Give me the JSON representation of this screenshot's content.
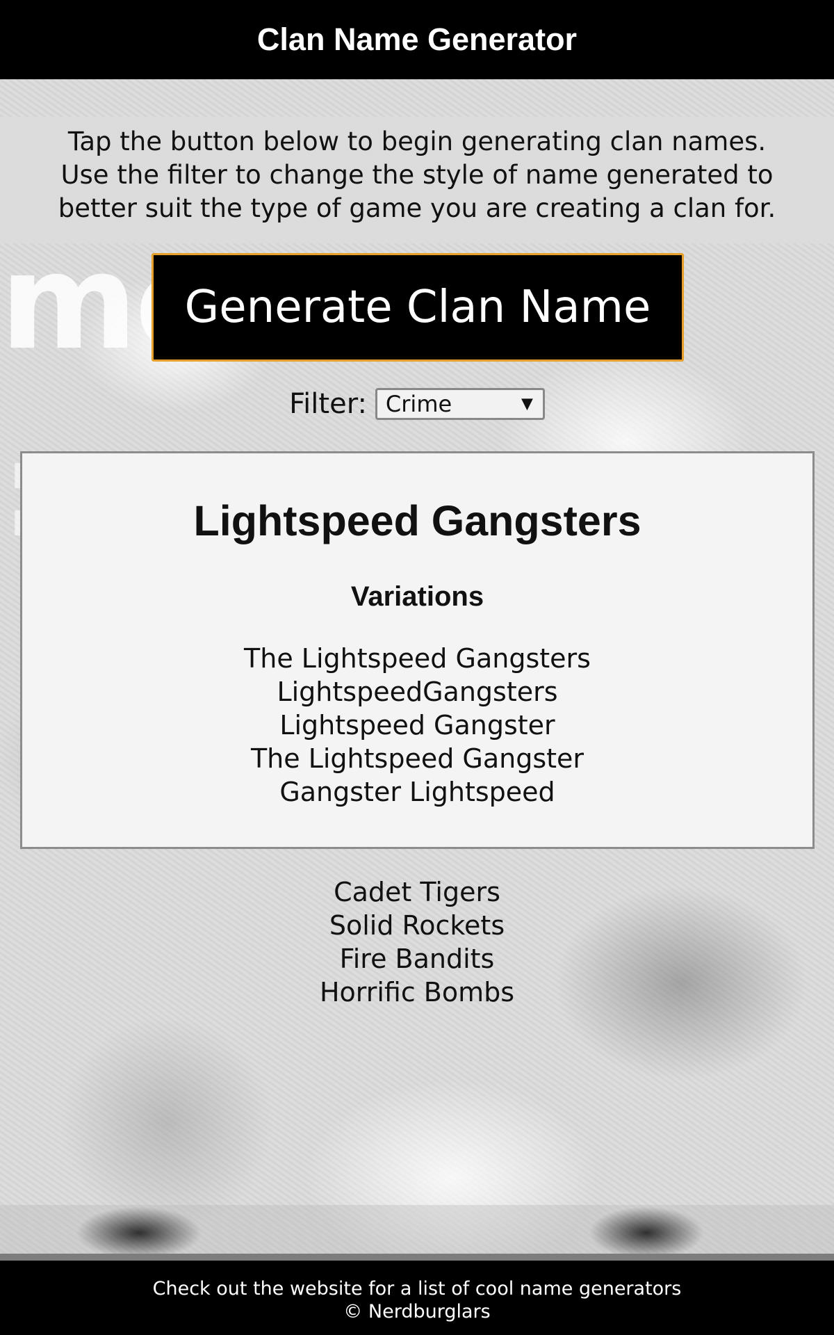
{
  "header": {
    "title": "Clan Name Generator"
  },
  "intro": {
    "lines": [
      "Tap the button below to begin generating clan names.",
      "Use the filter to change the style of name generated to",
      "better suit the type of game you are creating a clan for."
    ]
  },
  "generate_button": {
    "label": "Generate Clan Name"
  },
  "filter": {
    "label": "Filter:",
    "selected": "Crime"
  },
  "result": {
    "name": "Lightspeed Gangsters",
    "variations_title": "Variations",
    "variations": [
      "The Lightspeed Gangsters",
      "LightspeedGangsters",
      "Lightspeed Gangster",
      "The Lightspeed Gangster",
      "Gangster Lightspeed"
    ]
  },
  "history": [
    "Cadet Tigers",
    "Solid Rockets",
    "Fire Bandits",
    "Horrific Bombs"
  ],
  "footer": {
    "line1": "Check out the website for a list of cool name generators",
    "line2": "© Nerdburglars"
  },
  "colors": {
    "header_bg": "#000000",
    "button_border": "#e6a02a",
    "card_bg": "#f4f4f4"
  }
}
